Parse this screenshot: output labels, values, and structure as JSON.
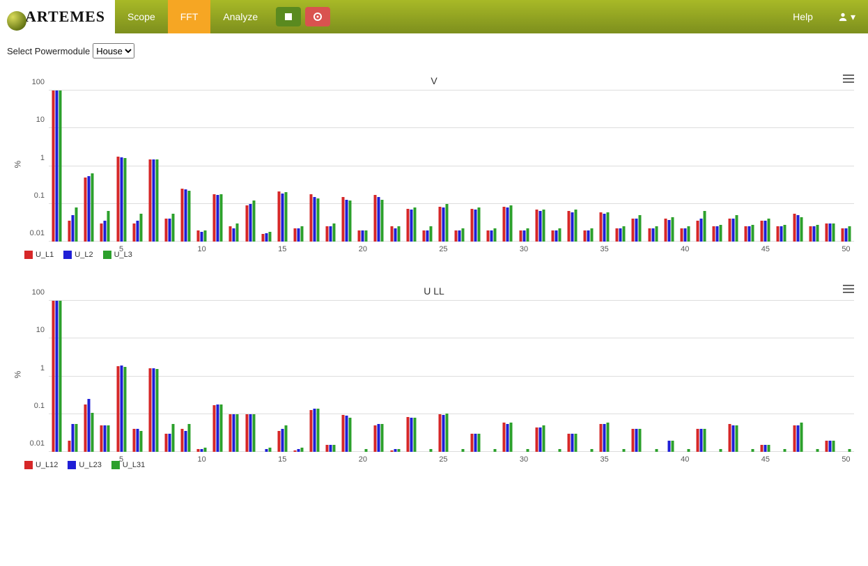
{
  "nav": {
    "brand": "ARTEMES",
    "items": [
      "Scope",
      "FFT",
      "Analyze"
    ],
    "active_index": 1,
    "help": "Help"
  },
  "controls": {
    "select_label": "Select Powermodule",
    "select_value": "House"
  },
  "chart_data": [
    {
      "type": "bar",
      "title": "V",
      "ylabel": "%",
      "ylim": [
        0.01,
        100
      ],
      "ylog": true,
      "yticks": [
        0.01,
        0.1,
        1,
        10,
        100
      ],
      "x": [
        1,
        2,
        3,
        4,
        5,
        6,
        7,
        8,
        9,
        10,
        11,
        12,
        13,
        14,
        15,
        16,
        17,
        18,
        19,
        20,
        21,
        22,
        23,
        24,
        25,
        26,
        27,
        28,
        29,
        30,
        31,
        32,
        33,
        34,
        35,
        36,
        37,
        38,
        39,
        40,
        41,
        42,
        43,
        44,
        45,
        46,
        47,
        48,
        49,
        50
      ],
      "xticks": [
        5,
        10,
        15,
        20,
        25,
        30,
        35,
        40,
        45,
        50
      ],
      "series": [
        {
          "name": "U_L1",
          "color": "s0",
          "values": [
            100,
            0.035,
            0.5,
            0.03,
            1.8,
            0.03,
            1.5,
            0.04,
            0.25,
            0.02,
            0.18,
            0.025,
            0.09,
            0.016,
            0.21,
            0.022,
            0.18,
            0.025,
            0.15,
            0.02,
            0.17,
            0.025,
            0.075,
            0.02,
            0.085,
            0.02,
            0.075,
            0.02,
            0.085,
            0.02,
            0.07,
            0.02,
            0.065,
            0.02,
            0.06,
            0.022,
            0.04,
            0.022,
            0.04,
            0.022,
            0.035,
            0.025,
            0.04,
            0.025,
            0.035,
            0.025,
            0.055,
            0.025,
            0.03,
            0.022
          ]
        },
        {
          "name": "U_L2",
          "color": "s1",
          "values": [
            100,
            0.05,
            0.55,
            0.035,
            1.7,
            0.035,
            1.5,
            0.04,
            0.24,
            0.018,
            0.17,
            0.022,
            0.1,
            0.017,
            0.19,
            0.022,
            0.15,
            0.025,
            0.13,
            0.02,
            0.15,
            0.022,
            0.07,
            0.02,
            0.08,
            0.02,
            0.07,
            0.02,
            0.08,
            0.02,
            0.065,
            0.02,
            0.06,
            0.02,
            0.055,
            0.022,
            0.04,
            0.022,
            0.038,
            0.022,
            0.04,
            0.025,
            0.04,
            0.025,
            0.035,
            0.025,
            0.05,
            0.025,
            0.03,
            0.022
          ]
        },
        {
          "name": "U_L3",
          "color": "s2",
          "values": [
            100,
            0.08,
            0.65,
            0.065,
            1.6,
            0.055,
            1.5,
            0.055,
            0.22,
            0.02,
            0.18,
            0.03,
            0.12,
            0.018,
            0.2,
            0.025,
            0.14,
            0.03,
            0.12,
            0.02,
            0.13,
            0.025,
            0.08,
            0.025,
            0.1,
            0.022,
            0.08,
            0.022,
            0.09,
            0.022,
            0.07,
            0.022,
            0.07,
            0.022,
            0.06,
            0.025,
            0.05,
            0.025,
            0.045,
            0.025,
            0.065,
            0.028,
            0.05,
            0.028,
            0.04,
            0.028,
            0.045,
            0.028,
            0.03,
            0.025
          ]
        }
      ]
    },
    {
      "type": "bar",
      "title": "U LL",
      "ylabel": "%",
      "ylim": [
        0.01,
        100
      ],
      "ylog": true,
      "yticks": [
        0.01,
        0.1,
        1,
        10,
        100
      ],
      "x": [
        1,
        2,
        3,
        4,
        5,
        6,
        7,
        8,
        9,
        10,
        11,
        12,
        13,
        14,
        15,
        16,
        17,
        18,
        19,
        20,
        21,
        22,
        23,
        24,
        25,
        26,
        27,
        28,
        29,
        30,
        31,
        32,
        33,
        34,
        35,
        36,
        37,
        38,
        39,
        40,
        41,
        42,
        43,
        44,
        45,
        46,
        47,
        48,
        49,
        50
      ],
      "xticks": [
        5,
        10,
        15,
        20,
        25,
        30,
        35,
        40,
        45,
        50
      ],
      "series": [
        {
          "name": "U_L12",
          "color": "s0",
          "values": [
            100,
            0.02,
            0.18,
            0.05,
            1.85,
            0.04,
            1.6,
            0.03,
            0.04,
            0.012,
            0.17,
            0.1,
            0.1,
            0.01,
            0.035,
            0.011,
            0.13,
            0.015,
            0.095,
            0.01,
            0.05,
            0.011,
            0.085,
            0.01,
            0.1,
            0.01,
            0.03,
            0.01,
            0.06,
            0.01,
            0.045,
            0.01,
            0.03,
            0.01,
            0.055,
            0.01,
            0.04,
            0.01,
            0.01,
            0.01,
            0.04,
            0.01,
            0.055,
            0.01,
            0.015,
            0.01,
            0.05,
            0.01,
            0.02,
            0.01
          ]
        },
        {
          "name": "U_L23",
          "color": "s1",
          "values": [
            100,
            0.055,
            0.25,
            0.05,
            1.9,
            0.04,
            1.6,
            0.03,
            0.035,
            0.012,
            0.18,
            0.1,
            0.1,
            0.012,
            0.04,
            0.012,
            0.14,
            0.015,
            0.09,
            0.01,
            0.055,
            0.012,
            0.08,
            0.01,
            0.095,
            0.01,
            0.03,
            0.01,
            0.055,
            0.01,
            0.045,
            0.01,
            0.03,
            0.01,
            0.055,
            0.01,
            0.04,
            0.01,
            0.02,
            0.01,
            0.04,
            0.01,
            0.05,
            0.01,
            0.015,
            0.01,
            0.05,
            0.01,
            0.02,
            0.01
          ]
        },
        {
          "name": "U_L31",
          "color": "s2",
          "values": [
            100,
            0.055,
            0.11,
            0.05,
            1.75,
            0.035,
            1.55,
            0.055,
            0.055,
            0.013,
            0.18,
            0.1,
            0.1,
            0.013,
            0.05,
            0.013,
            0.14,
            0.015,
            0.08,
            0.012,
            0.055,
            0.012,
            0.08,
            0.012,
            0.105,
            0.012,
            0.03,
            0.012,
            0.06,
            0.012,
            0.05,
            0.012,
            0.03,
            0.012,
            0.06,
            0.012,
            0.04,
            0.012,
            0.02,
            0.012,
            0.04,
            0.012,
            0.05,
            0.012,
            0.015,
            0.012,
            0.06,
            0.012,
            0.02,
            0.012
          ]
        }
      ]
    }
  ]
}
